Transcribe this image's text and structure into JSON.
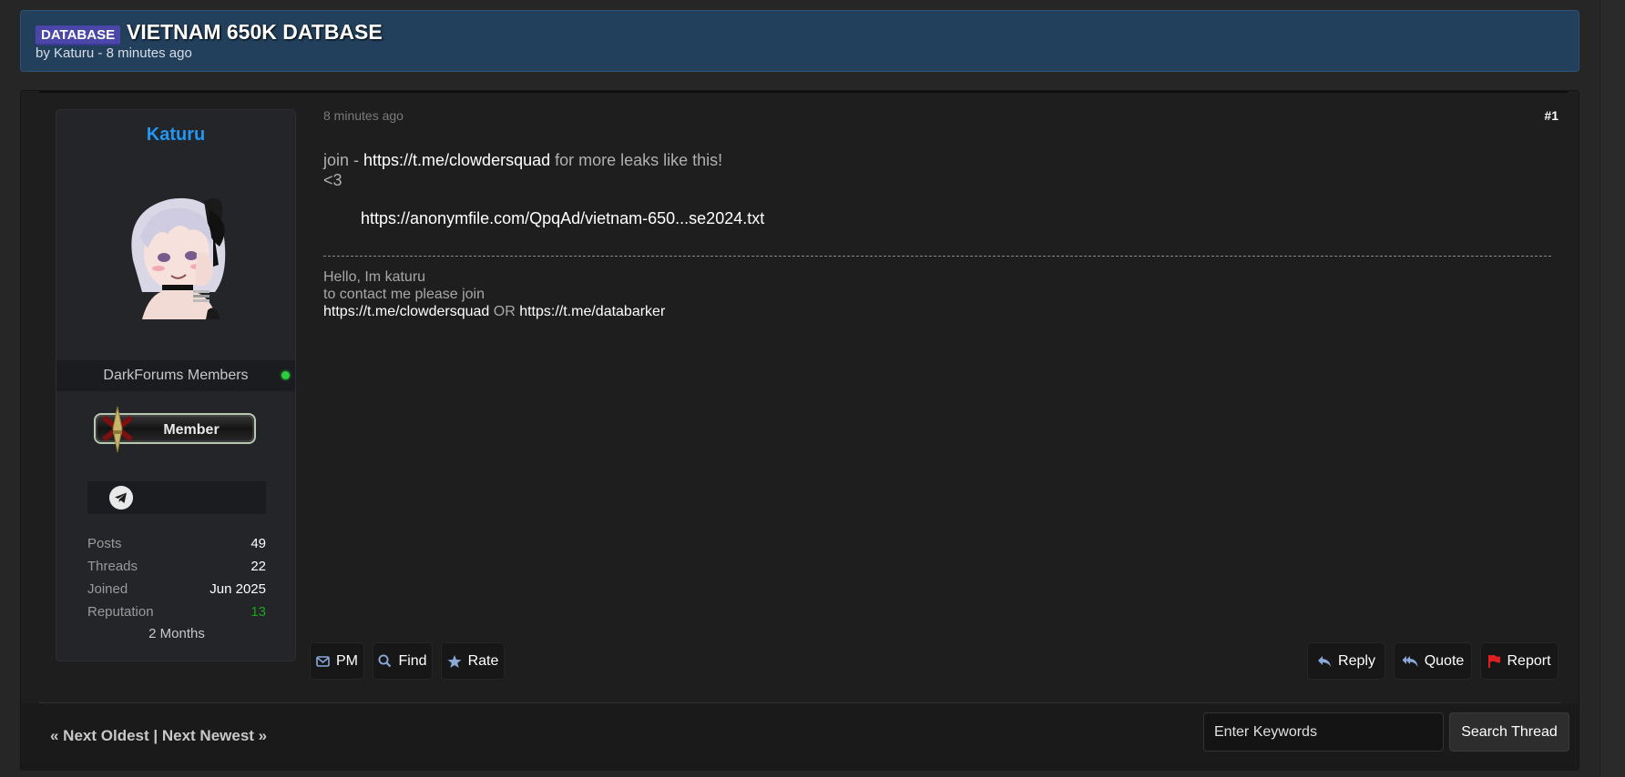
{
  "thread": {
    "prefix": "DATABASE",
    "title": "VIETNAM 650K DATBASE",
    "by_label": "by",
    "author": "Katuru",
    "time_sep": " - ",
    "time": "8 minutes ago"
  },
  "author_box": {
    "name": "Katuru",
    "usergroup": "DarkForums Members",
    "rank_badge": "Member",
    "stats": [
      {
        "label": "Posts",
        "value": "49"
      },
      {
        "label": "Threads",
        "value": "22"
      },
      {
        "label": "Joined",
        "value": "Jun 2025"
      },
      {
        "label": "Reputation",
        "value": "13"
      }
    ],
    "member_for": "2 Months"
  },
  "post": {
    "time": "8 minutes ago",
    "number": "#1",
    "line1_prefix": "join - ",
    "line1_link": "https://t.me/clowdersquad",
    "line1_suffix": " for more leaks like this!",
    "line2": "<3",
    "download_link": "https://anonymfile.com/QpqAd/vietnam-650...se2024.txt"
  },
  "signature": {
    "line1": "Hello, Im katuru",
    "line2": "to contact me please join",
    "link1": "https://t.me/clowdersquad",
    "or": " OR ",
    "link2": "https://t.me/databarker"
  },
  "buttons": {
    "pm": "PM",
    "find": "Find",
    "rate": "Rate",
    "reply": "Reply",
    "quote": "Quote",
    "report": "Report"
  },
  "footer": {
    "next_oldest": "« Next Oldest",
    "sep": " | ",
    "next_newest": "Next Newest »",
    "search_placeholder": "Enter Keywords",
    "search_button": "Search Thread"
  },
  "colors": {
    "header_bg": "#22405c",
    "prefix_bg": "#4a47a8",
    "author_name": "#2196f3",
    "reputation": "#1aa51a",
    "report_flag": "#e02020",
    "icon_blue": "#8aa8d8"
  }
}
